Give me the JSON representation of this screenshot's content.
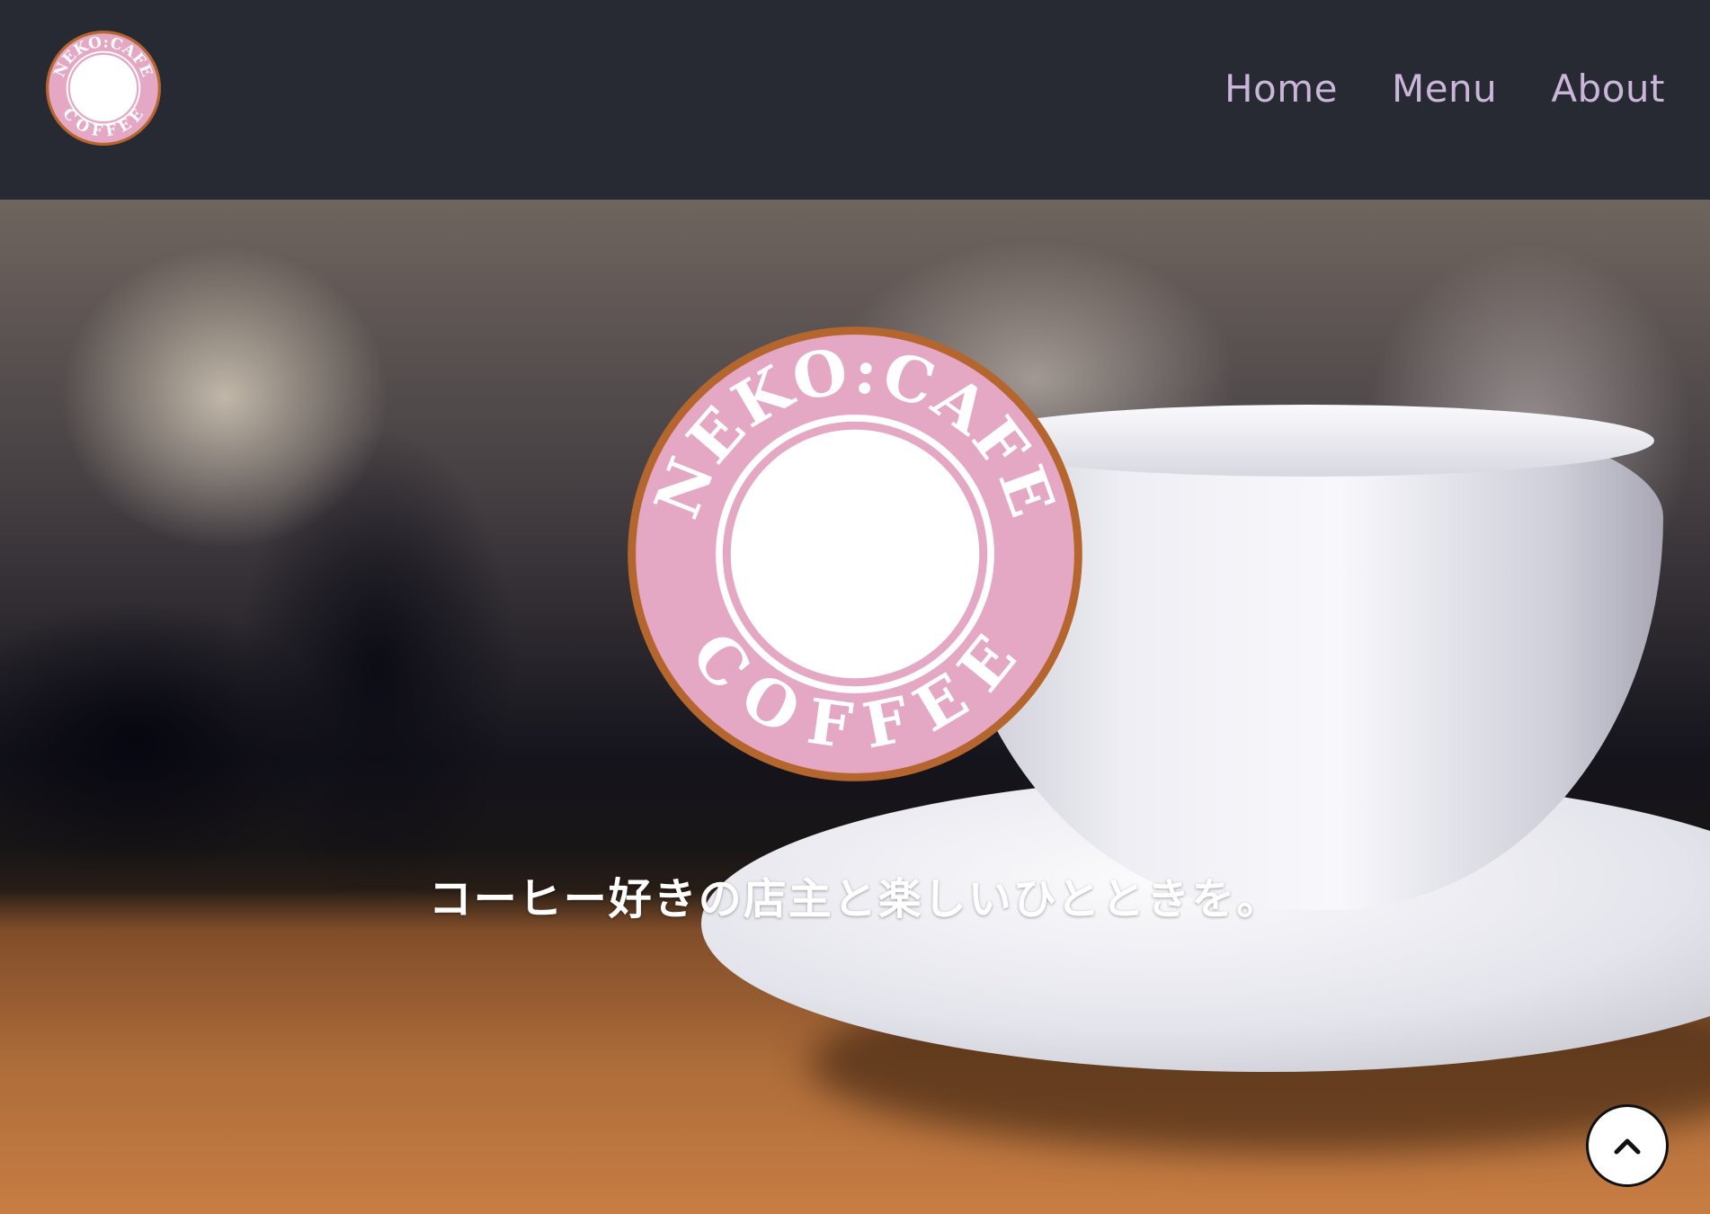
{
  "header": {
    "logo": {
      "top_text": "NEKO:CAFE",
      "bottom_text": "COFFEE"
    },
    "nav": [
      {
        "label": "Home"
      },
      {
        "label": "Menu"
      },
      {
        "label": "About"
      }
    ]
  },
  "hero": {
    "logo": {
      "top_text": "NEKO:CAFE",
      "bottom_text": "COFFEE"
    },
    "tagline": "コーヒー好きの店主と楽しいひとときを。"
  },
  "scroll_top": {
    "icon": "chevron-up-icon"
  },
  "colors": {
    "header_bg": "#272a33",
    "nav_text": "#c9b6d8",
    "logo_pink": "#e4a8c4",
    "logo_ring": "#b4662e"
  }
}
